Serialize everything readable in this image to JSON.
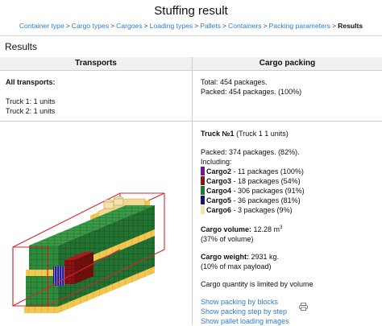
{
  "page": {
    "title": "Stuffing result",
    "section_title": "Results"
  },
  "breadcrumb": {
    "items": [
      "Container type",
      "Cargo types",
      "Cargoes",
      "Loading types",
      "Pallets",
      "Containers",
      "Packing parameters"
    ],
    "separator": ">",
    "current": "Results"
  },
  "table": {
    "headers": [
      "Transports",
      "Cargo packing"
    ],
    "summary": {
      "transports_title": "All transports:",
      "transports": [
        "Truck 1: 1 units",
        "Truck 2: 1 units"
      ],
      "total": "Total: 454 packages.",
      "packed": "Packed: 454 packages. (100%)"
    },
    "truck": {
      "title": "Truck №1",
      "title_suffix": "(Truck 1 1 units)",
      "packed": "Packed: 374 packages. (82%).",
      "including_label": "Including:",
      "cargoes": [
        {
          "name": "Cargo2",
          "text": "- 11 packages (100%)",
          "color": "#6a1a96"
        },
        {
          "name": "Cargo3",
          "text": "- 18 packages (54%)",
          "color": "#8b1414"
        },
        {
          "name": "Cargo4",
          "text": "- 306 packages (91%)",
          "color": "#1f7a2e"
        },
        {
          "name": "Cargo5",
          "text": "- 36 packages (81%)",
          "color": "#17127a"
        },
        {
          "name": "Cargo6",
          "text": "- 3 packages (9%)",
          "color": "#f5e4a6"
        }
      ],
      "volume_label": "Cargo volume:",
      "volume_value": "12.28 m",
      "volume_sup": "3",
      "volume_pct": "(37% of volume)",
      "weight_label": "Cargo weight:",
      "weight_value": "2931 kg.",
      "weight_pct": "(10% of max payload)",
      "limit_note": "Cargo quantity is limited by volume"
    },
    "links": {
      "show_blocks": "Show packing by blocks",
      "show_step": "Show packing step by step",
      "show_pallet": "Show pallet loading images"
    }
  },
  "icons": {
    "print": "print-icon"
  },
  "colors": {
    "link": "#2f7ad0",
    "header_bg": "#f0f0f0",
    "container_outline": "#d7262b",
    "cargo_green": "#2f8a3c",
    "pallet_yellow": "#f3c64f"
  }
}
